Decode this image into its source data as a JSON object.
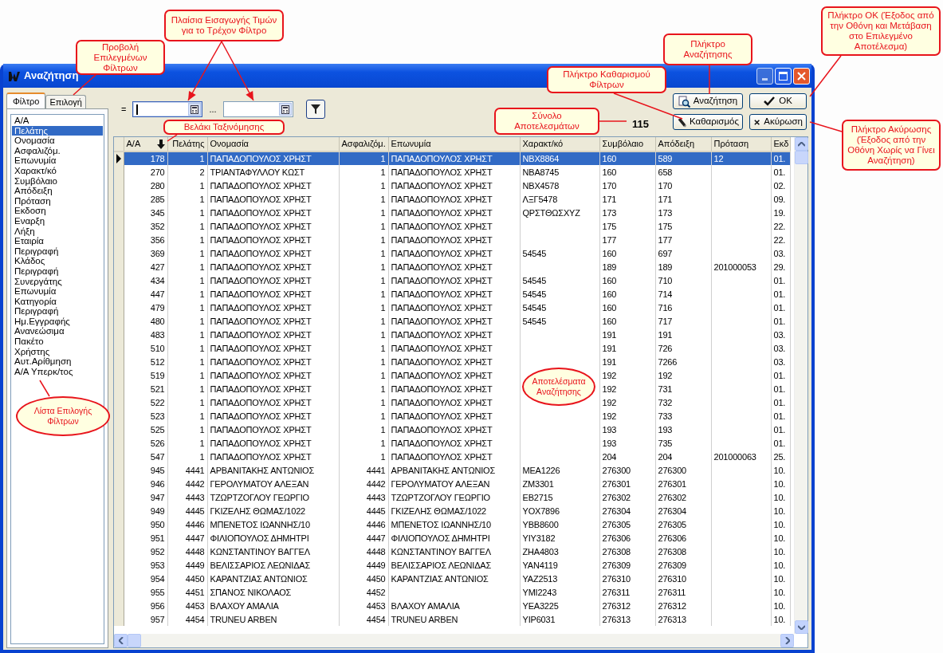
{
  "window": {
    "title": "Αναζήτηση"
  },
  "side_tabs": [
    {
      "label": "Φίλτρο",
      "selected": true
    },
    {
      "label": "Επιλογή",
      "selected": false
    }
  ],
  "filter_list": [
    {
      "label": "Α/Α",
      "selected": false
    },
    {
      "label": "Πελάτης",
      "selected": true
    },
    {
      "label": "Ονομασία",
      "selected": false
    },
    {
      "label": "Ασφαλιζόμ.",
      "selected": false
    },
    {
      "label": "Επωνυμία",
      "selected": false
    },
    {
      "label": "Χαρακτ/κό",
      "selected": false
    },
    {
      "label": "Συμβόλαιο",
      "selected": false
    },
    {
      "label": "Απόδειξη",
      "selected": false
    },
    {
      "label": "Πρόταση",
      "selected": false
    },
    {
      "label": "Εκδοση",
      "selected": false
    },
    {
      "label": "Εναρξη",
      "selected": false
    },
    {
      "label": "Λήξη",
      "selected": false
    },
    {
      "label": "Εταιρία",
      "selected": false
    },
    {
      "label": "Περιγραφή",
      "selected": false
    },
    {
      "label": "Κλάδος",
      "selected": false
    },
    {
      "label": "Περιγραφή",
      "selected": false
    },
    {
      "label": "Συνεργάτης",
      "selected": false
    },
    {
      "label": "Επωνυμία",
      "selected": false
    },
    {
      "label": "Κατηγορία",
      "selected": false
    },
    {
      "label": "Περιγραφή",
      "selected": false
    },
    {
      "label": "Ημ.Εγγραφής",
      "selected": false
    },
    {
      "label": "Ανανεώσιμα",
      "selected": false
    },
    {
      "label": "Πακέτο",
      "selected": false
    },
    {
      "label": "Χρήστης",
      "selected": false
    },
    {
      "label": "Αυτ.Αρίθμηση",
      "selected": false
    },
    {
      "label": "Α/Α Υπερκ/τος",
      "selected": false
    }
  ],
  "filter_bar": {
    "operator": "=",
    "separator": "...",
    "fields": [
      {
        "focused": true
      },
      {
        "focused": false
      }
    ]
  },
  "total": "115",
  "buttons": [
    {
      "kind": "search",
      "label": "Αναζήτηση"
    },
    {
      "kind": "ok",
      "label": "OK"
    },
    {
      "kind": "clear",
      "label": "Καθαρισμός"
    },
    {
      "kind": "cancel",
      "label": "Ακύρωση"
    }
  ],
  "table": {
    "columns": [
      {
        "label": "Α/Α",
        "kind": "number",
        "sorted": true
      },
      {
        "label": "Πελάτης",
        "kind": "number",
        "sorted": false
      },
      {
        "label": "Ονομασία",
        "kind": "text",
        "sorted": false
      },
      {
        "label": "Ασφαλιζόμ.",
        "kind": "number",
        "sorted": false
      },
      {
        "label": "Επωνυμία",
        "kind": "text",
        "sorted": false
      },
      {
        "label": "Χαρακτ/κό",
        "kind": "text",
        "sorted": false
      },
      {
        "label": "Συμβόλαιο",
        "kind": "text",
        "sorted": false
      },
      {
        "label": "Απόδειξη",
        "kind": "text",
        "sorted": false
      },
      {
        "label": "Πρόταση",
        "kind": "text",
        "sorted": false
      },
      {
        "label": "Εκδ",
        "kind": "text",
        "sorted": false
      }
    ],
    "rows": [
      {
        "selected": true,
        "cells": [
          "178",
          "1",
          "ΠΑΠΑΔΟΠΟΥΛΟΣ ΧΡΗΣΤ",
          "1",
          "ΠΑΠΑΔΟΠΟΥΛΟΣ ΧΡΗΣΤ",
          "NBX8864",
          "160",
          "589",
          "12",
          "01."
        ]
      },
      {
        "selected": false,
        "cells": [
          "270",
          "2",
          "ΤΡΙΑΝΤΑΦΥΛΛΟΥ ΚΩΣΤ",
          "1",
          "ΠΑΠΑΔΟΠΟΥΛΟΣ ΧΡΗΣΤ",
          "NBA8745",
          "160",
          "658",
          null,
          "01."
        ]
      },
      {
        "selected": false,
        "cells": [
          "280",
          "1",
          "ΠΑΠΑΔΟΠΟΥΛΟΣ ΧΡΗΣΤ",
          "1",
          "ΠΑΠΑΔΟΠΟΥΛΟΣ ΧΡΗΣΤ",
          "NBX4578",
          "170",
          "170",
          null,
          "02."
        ]
      },
      {
        "selected": false,
        "cells": [
          "285",
          "1",
          "ΠΑΠΑΔΟΠΟΥΛΟΣ ΧΡΗΣΤ",
          "1",
          "ΠΑΠΑΔΟΠΟΥΛΟΣ ΧΡΗΣΤ",
          "ΛΞΓ5478",
          "171",
          "171",
          null,
          "09."
        ]
      },
      {
        "selected": false,
        "cells": [
          "345",
          "1",
          "ΠΑΠΑΔΟΠΟΥΛΟΣ ΧΡΗΣΤ",
          "1",
          "ΠΑΠΑΔΟΠΟΥΛΟΣ ΧΡΗΣΤ",
          "QΡΣΤΘΩΣΧΥΖ",
          "173",
          "173",
          null,
          "19."
        ]
      },
      {
        "selected": false,
        "cells": [
          "352",
          "1",
          "ΠΑΠΑΔΟΠΟΥΛΟΣ ΧΡΗΣΤ",
          "1",
          "ΠΑΠΑΔΟΠΟΥΛΟΣ ΧΡΗΣΤ",
          null,
          "175",
          "175",
          null,
          "22."
        ]
      },
      {
        "selected": false,
        "cells": [
          "356",
          "1",
          "ΠΑΠΑΔΟΠΟΥΛΟΣ ΧΡΗΣΤ",
          "1",
          "ΠΑΠΑΔΟΠΟΥΛΟΣ ΧΡΗΣΤ",
          null,
          "177",
          "177",
          null,
          "22."
        ]
      },
      {
        "selected": false,
        "cells": [
          "369",
          "1",
          "ΠΑΠΑΔΟΠΟΥΛΟΣ ΧΡΗΣΤ",
          "1",
          "ΠΑΠΑΔΟΠΟΥΛΟΣ ΧΡΗΣΤ",
          "54545",
          "160",
          "697",
          null,
          "03."
        ]
      },
      {
        "selected": false,
        "cells": [
          "427",
          "1",
          "ΠΑΠΑΔΟΠΟΥΛΟΣ ΧΡΗΣΤ",
          "1",
          "ΠΑΠΑΔΟΠΟΥΛΟΣ ΧΡΗΣΤ",
          null,
          "189",
          "189",
          "201000053",
          "29."
        ]
      },
      {
        "selected": false,
        "cells": [
          "434",
          "1",
          "ΠΑΠΑΔΟΠΟΥΛΟΣ ΧΡΗΣΤ",
          "1",
          "ΠΑΠΑΔΟΠΟΥΛΟΣ ΧΡΗΣΤ",
          "54545",
          "160",
          "710",
          null,
          "01."
        ]
      },
      {
        "selected": false,
        "cells": [
          "447",
          "1",
          "ΠΑΠΑΔΟΠΟΥΛΟΣ ΧΡΗΣΤ",
          "1",
          "ΠΑΠΑΔΟΠΟΥΛΟΣ ΧΡΗΣΤ",
          "54545",
          "160",
          "714",
          null,
          "01."
        ]
      },
      {
        "selected": false,
        "cells": [
          "479",
          "1",
          "ΠΑΠΑΔΟΠΟΥΛΟΣ ΧΡΗΣΤ",
          "1",
          "ΠΑΠΑΔΟΠΟΥΛΟΣ ΧΡΗΣΤ",
          "54545",
          "160",
          "716",
          null,
          "01."
        ]
      },
      {
        "selected": false,
        "cells": [
          "480",
          "1",
          "ΠΑΠΑΔΟΠΟΥΛΟΣ ΧΡΗΣΤ",
          "1",
          "ΠΑΠΑΔΟΠΟΥΛΟΣ ΧΡΗΣΤ",
          "54545",
          "160",
          "717",
          null,
          "01."
        ]
      },
      {
        "selected": false,
        "cells": [
          "483",
          "1",
          "ΠΑΠΑΔΟΠΟΥΛΟΣ ΧΡΗΣΤ",
          "1",
          "ΠΑΠΑΔΟΠΟΥΛΟΣ ΧΡΗΣΤ",
          null,
          "191",
          "191",
          null,
          "03."
        ]
      },
      {
        "selected": false,
        "cells": [
          "510",
          "1",
          "ΠΑΠΑΔΟΠΟΥΛΟΣ ΧΡΗΣΤ",
          "1",
          "ΠΑΠΑΔΟΠΟΥΛΟΣ ΧΡΗΣΤ",
          null,
          "191",
          "726",
          null,
          "03."
        ]
      },
      {
        "selected": false,
        "cells": [
          "512",
          "1",
          "ΠΑΠΑΔΟΠΟΥΛΟΣ ΧΡΗΣΤ",
          "1",
          "ΠΑΠΑΔΟΠΟΥΛΟΣ ΧΡΗΣΤ",
          null,
          "191",
          "7266",
          null,
          "03."
        ]
      },
      {
        "selected": false,
        "cells": [
          "519",
          "1",
          "ΠΑΠΑΔΟΠΟΥΛΟΣ ΧΡΗΣΤ",
          "1",
          "ΠΑΠΑΔΟΠΟΥΛΟΣ ΧΡΗΣΤ",
          null,
          "192",
          "192",
          null,
          "01."
        ]
      },
      {
        "selected": false,
        "cells": [
          "521",
          "1",
          "ΠΑΠΑΔΟΠΟΥΛΟΣ ΧΡΗΣΤ",
          "1",
          "ΠΑΠΑΔΟΠΟΥΛΟΣ ΧΡΗΣΤ",
          null,
          "192",
          "731",
          null,
          "01."
        ]
      },
      {
        "selected": false,
        "cells": [
          "522",
          "1",
          "ΠΑΠΑΔΟΠΟΥΛΟΣ ΧΡΗΣΤ",
          "1",
          "ΠΑΠΑΔΟΠΟΥΛΟΣ ΧΡΗΣΤ",
          null,
          "192",
          "732",
          null,
          "01."
        ]
      },
      {
        "selected": false,
        "cells": [
          "523",
          "1",
          "ΠΑΠΑΔΟΠΟΥΛΟΣ ΧΡΗΣΤ",
          "1",
          "ΠΑΠΑΔΟΠΟΥΛΟΣ ΧΡΗΣΤ",
          null,
          "192",
          "733",
          null,
          "01."
        ]
      },
      {
        "selected": false,
        "cells": [
          "525",
          "1",
          "ΠΑΠΑΔΟΠΟΥΛΟΣ ΧΡΗΣΤ",
          "1",
          "ΠΑΠΑΔΟΠΟΥΛΟΣ ΧΡΗΣΤ",
          null,
          "193",
          "193",
          null,
          "01."
        ]
      },
      {
        "selected": false,
        "cells": [
          "526",
          "1",
          "ΠΑΠΑΔΟΠΟΥΛΟΣ ΧΡΗΣΤ",
          "1",
          "ΠΑΠΑΔΟΠΟΥΛΟΣ ΧΡΗΣΤ",
          null,
          "193",
          "735",
          null,
          "01."
        ]
      },
      {
        "selected": false,
        "cells": [
          "547",
          "1",
          "ΠΑΠΑΔΟΠΟΥΛΟΣ ΧΡΗΣΤ",
          "1",
          "ΠΑΠΑΔΟΠΟΥΛΟΣ ΧΡΗΣΤ",
          null,
          "204",
          "204",
          "201000063",
          "25."
        ]
      },
      {
        "selected": false,
        "cells": [
          "945",
          "4441",
          "ΑΡΒΑΝΙΤΑΚΗΣ ΑΝΤΩΝΙΟΣ",
          "4441",
          "ΑΡΒΑΝΙΤΑΚΗΣ ΑΝΤΩΝΙΟΣ",
          "MEA1226",
          "276300",
          "276300",
          null,
          "10."
        ]
      },
      {
        "selected": false,
        "cells": [
          "946",
          "4442",
          "ΓΕΡΟΛΥΜΑΤΟΥ ΑΛΕΞΑΝ",
          "4442",
          "ΓΕΡΟΛΥΜΑΤΟΥ ΑΛΕΞΑΝ",
          "ZM3301",
          "276301",
          "276301",
          null,
          "10."
        ]
      },
      {
        "selected": false,
        "cells": [
          "947",
          "4443",
          "ΤΖΩΡΤΖΟΓΛΟΥ ΓΕΩΡΓΙΟ",
          "4443",
          "ΤΖΩΡΤΖΟΓΛΟΥ ΓΕΩΡΓΙΟ",
          "EB2715",
          "276302",
          "276302",
          null,
          "10."
        ]
      },
      {
        "selected": false,
        "cells": [
          "949",
          "4445",
          "ΓΚΙΖΕΛΗΣ ΘΩΜΑΣ/1022",
          "4445",
          "ΓΚΙΖΕΛΗΣ ΘΩΜΑΣ/1022",
          "YOX7896",
          "276304",
          "276304",
          null,
          "10."
        ]
      },
      {
        "selected": false,
        "cells": [
          "950",
          "4446",
          "ΜΠΕΝΕΤΟΣ ΙΩΑΝΝΗΣ/10",
          "4446",
          "ΜΠΕΝΕΤΟΣ ΙΩΑΝΝΗΣ/10",
          "YBB8600",
          "276305",
          "276305",
          null,
          "10."
        ]
      },
      {
        "selected": false,
        "cells": [
          "951",
          "4447",
          "ΦΙΛΙΟΠΟΥΛΟΣ ΔΗΜΗΤΡΙ",
          "4447",
          "ΦΙΛΙΟΠΟΥΛΟΣ ΔΗΜΗΤΡΙ",
          "YIY3182",
          "276306",
          "276306",
          null,
          "10."
        ]
      },
      {
        "selected": false,
        "cells": [
          "952",
          "4448",
          "ΚΩΝΣΤΑΝΤΙΝΟΥ ΒΑΓΓΕΛ",
          "4448",
          "ΚΩΝΣΤΑΝΤΙΝΟΥ ΒΑΓΓΕΛ",
          "ZHA4803",
          "276308",
          "276308",
          null,
          "10."
        ]
      },
      {
        "selected": false,
        "cells": [
          "953",
          "4449",
          "ΒΕΛΙΣΣΑΡΙΟΣ ΛΕΩΝΙΔΑΣ",
          "4449",
          "ΒΕΛΙΣΣΑΡΙΟΣ ΛΕΩΝΙΔΑΣ",
          "YAN4119",
          "276309",
          "276309",
          null,
          "10."
        ]
      },
      {
        "selected": false,
        "cells": [
          "954",
          "4450",
          "ΚΑΡΑΝΤΖΙΑΣ ΑΝΤΩΝΙΟΣ",
          "4450",
          "ΚΑΡΑΝΤΖΙΑΣ ΑΝΤΩΝΙΟΣ",
          "YAZ2513",
          "276310",
          "276310",
          null,
          "10."
        ]
      },
      {
        "selected": false,
        "cells": [
          "955",
          "4451",
          "ΣΠΑΝΟΣ ΝΙΚΟΛΑΟΣ",
          "4452",
          null,
          "YMI2243",
          "276311",
          "276311",
          null,
          "10."
        ]
      },
      {
        "selected": false,
        "cells": [
          "956",
          "4453",
          "ΒΛΑΧΟΥ ΑΜΑΛΙΑ",
          "4453",
          "ΒΛΑΧΟΥ ΑΜΑΛΙΑ",
          "YEA3225",
          "276312",
          "276312",
          null,
          "10."
        ]
      },
      {
        "selected": false,
        "cells": [
          "957",
          "4454",
          "TRUNEU ARBEN",
          "4454",
          "TRUNEU ARBEN",
          "YIP6031",
          "276313",
          "276313",
          null,
          "10."
        ]
      }
    ]
  },
  "annotations": [
    {
      "kind": "box",
      "text": "Προβολή Επιλεγμένων Φίλτρων"
    },
    {
      "kind": "box",
      "text": "Πλαίσια Εισαγωγής Τιμών για το Τρέχον Φίλτρο"
    },
    {
      "kind": "box",
      "text": "Βελάκι Ταξινόμησης"
    },
    {
      "kind": "ellipse",
      "text": "Λίστα Επιλογής Φίλτρων"
    },
    {
      "kind": "box",
      "text": "Σύνολο Αποτελεσμάτων"
    },
    {
      "kind": "ellipse",
      "text": "Αποτελέσματα Αναζήτησης"
    },
    {
      "kind": "box",
      "text": "Πλήκτρο Αναζήτησης"
    },
    {
      "kind": "box",
      "text": "Πλήκτρο Καθαρισμού Φίλτρων"
    },
    {
      "kind": "box",
      "text": "Πλήκτρο ΟΚ (Έξοδος από την Οθόνη και Μετάβαση στο Επιλεγμένο Αποτέλεσμα)"
    },
    {
      "kind": "box",
      "text": "Πλήκτρο Ακύρωσης (Έξοδος από την Οθόνη Χωρίς να Γίνει Αναζήτηση)"
    }
  ]
}
